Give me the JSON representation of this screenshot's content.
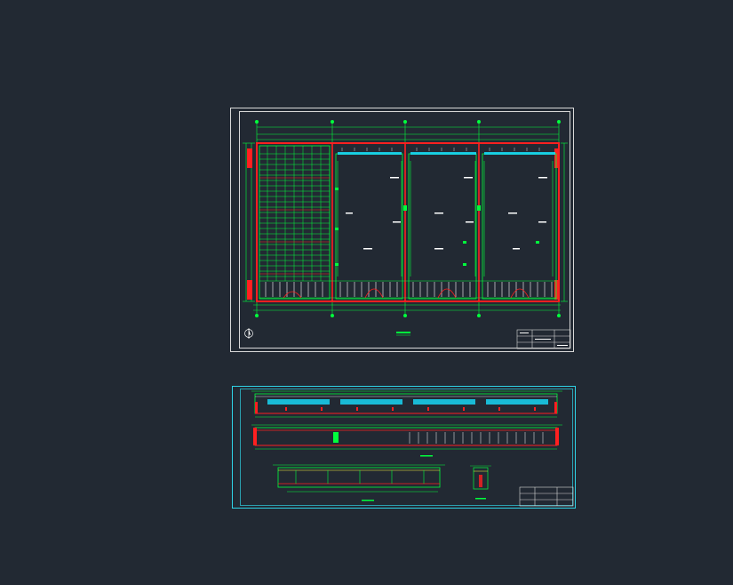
{
  "colors": {
    "background": "#222933",
    "sheet1_border": "#d8d8d8",
    "sheet2_border": "#2fd3e6",
    "wall_red": "#ff2020",
    "dimension_green": "#00ff3c",
    "hatch_cyan": "#18e0ff",
    "text_white": "#ffffff"
  },
  "drawing1": {
    "north_symbol": "north-arrow-icon",
    "columns": 3
  },
  "drawing2": {
    "sections": 2,
    "details": 2
  }
}
